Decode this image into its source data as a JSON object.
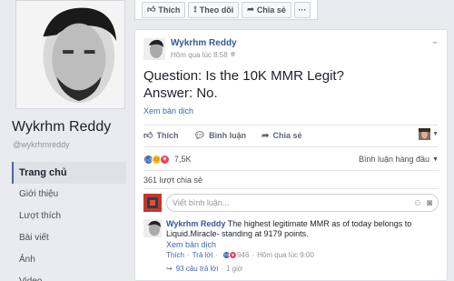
{
  "sidebar": {
    "name": "Wykrhm Reddy",
    "handle": "@wykrhmreddy",
    "nav": [
      {
        "label": "Trang chủ",
        "active": true
      },
      {
        "label": "Giới thiệu"
      },
      {
        "label": "Lượt thích"
      },
      {
        "label": "Bài viết"
      },
      {
        "label": "Ảnh"
      },
      {
        "label": "Video"
      }
    ]
  },
  "top_actions": {
    "like": "Thích",
    "follow": "Theo dõi",
    "share": "Chia sẻ",
    "more": "···"
  },
  "post": {
    "author": "Wykrhm Reddy",
    "time": "Hôm qua lúc 8:58",
    "line1": "Question: Is the 10K MMR Legit?",
    "line2": "Answer: No.",
    "translate": "Xem bản dịch",
    "actions": {
      "like": "Thích",
      "comment": "Bình luận",
      "share": "Chia sẻ"
    },
    "reactions_count": "7,5K",
    "top_comments": "Bình luận hàng đầu",
    "shares": "361 lượt chia sẻ",
    "comment_placeholder": "Viết bình luận..."
  },
  "comment": {
    "author": "Wykrhm Reddy",
    "text": "The highest legitimate MMR as of today belongs to Liquid.Miracle- standing at 9179 points.",
    "translate": "Xem bản dịch",
    "like": "Thích",
    "reply": "Trả lời",
    "reaction_count": "946",
    "time": "Hôm qua lúc 9:00",
    "replies": "93 câu trả lời",
    "replies_time": "1 giờ"
  },
  "colors": {
    "accent": "#4267b2",
    "link": "#365899",
    "background": "#e9ebee"
  }
}
